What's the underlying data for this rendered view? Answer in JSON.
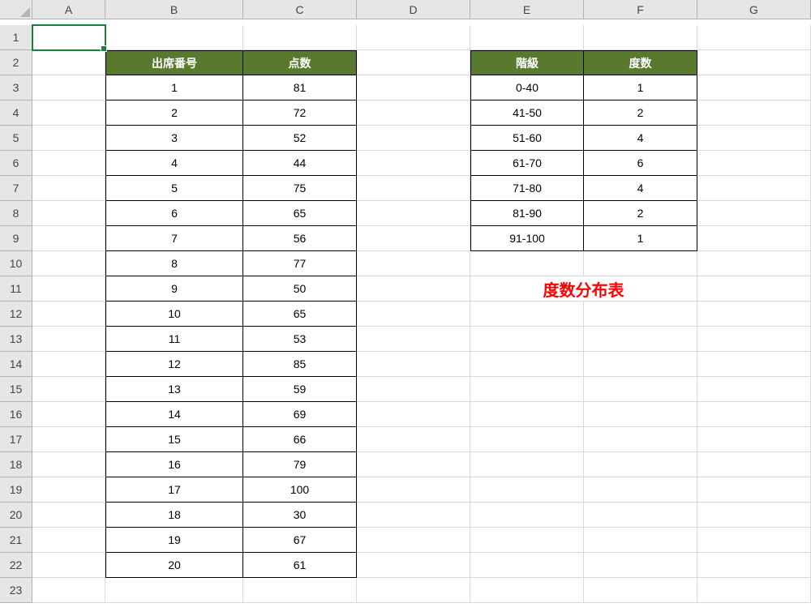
{
  "columns": [
    "A",
    "B",
    "C",
    "D",
    "E",
    "F",
    "G"
  ],
  "rows": 23,
  "active_cell": "A1",
  "table1": {
    "headers": [
      "出席番号",
      "点数"
    ],
    "rows": [
      [
        1,
        81
      ],
      [
        2,
        72
      ],
      [
        3,
        52
      ],
      [
        4,
        44
      ],
      [
        5,
        75
      ],
      [
        6,
        65
      ],
      [
        7,
        56
      ],
      [
        8,
        77
      ],
      [
        9,
        50
      ],
      [
        10,
        65
      ],
      [
        11,
        53
      ],
      [
        12,
        85
      ],
      [
        13,
        59
      ],
      [
        14,
        69
      ],
      [
        15,
        66
      ],
      [
        16,
        79
      ],
      [
        17,
        100
      ],
      [
        18,
        30
      ],
      [
        19,
        67
      ],
      [
        20,
        61
      ]
    ]
  },
  "table2": {
    "headers": [
      "階級",
      "度数"
    ],
    "rows": [
      [
        "0-40",
        1
      ],
      [
        "41-50",
        2
      ],
      [
        "51-60",
        4
      ],
      [
        "61-70",
        6
      ],
      [
        "71-80",
        4
      ],
      [
        "81-90",
        2
      ],
      [
        "91-100",
        1
      ]
    ]
  },
  "label": "度数分布表",
  "chart_data": {
    "type": "table",
    "title": "度数分布表",
    "series": [
      {
        "name": "出席番号/点数",
        "columns": [
          "出席番号",
          "点数"
        ],
        "data": [
          [
            1,
            81
          ],
          [
            2,
            72
          ],
          [
            3,
            52
          ],
          [
            4,
            44
          ],
          [
            5,
            75
          ],
          [
            6,
            65
          ],
          [
            7,
            56
          ],
          [
            8,
            77
          ],
          [
            9,
            50
          ],
          [
            10,
            65
          ],
          [
            11,
            53
          ],
          [
            12,
            85
          ],
          [
            13,
            59
          ],
          [
            14,
            69
          ],
          [
            15,
            66
          ],
          [
            16,
            79
          ],
          [
            17,
            100
          ],
          [
            18,
            30
          ],
          [
            19,
            67
          ],
          [
            20,
            61
          ]
        ]
      },
      {
        "name": "階級/度数",
        "columns": [
          "階級",
          "度数"
        ],
        "data": [
          [
            "0-40",
            1
          ],
          [
            "41-50",
            2
          ],
          [
            "51-60",
            4
          ],
          [
            "61-70",
            6
          ],
          [
            "71-80",
            4
          ],
          [
            "81-90",
            2
          ],
          [
            "91-100",
            1
          ]
        ]
      }
    ]
  }
}
